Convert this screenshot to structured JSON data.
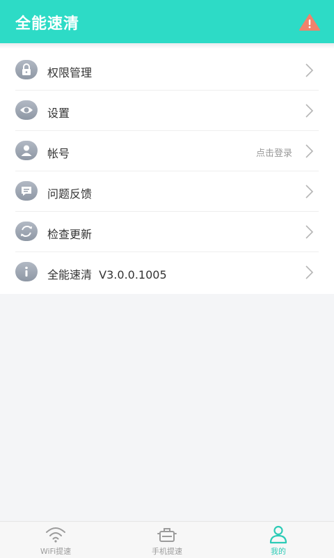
{
  "header": {
    "title": "全能速清",
    "alert_icon": "warning-triangle-icon",
    "accent_color": "#2ddbc6"
  },
  "menu": {
    "items": [
      {
        "icon": "lock-icon",
        "label": "权限管理",
        "value": ""
      },
      {
        "icon": "eye-settings-icon",
        "label": "设置",
        "value": ""
      },
      {
        "icon": "user-icon",
        "label": "帐号",
        "value": "点击登录"
      },
      {
        "icon": "message-icon",
        "label": "问题反馈",
        "value": ""
      },
      {
        "icon": "refresh-icon",
        "label": "检查更新",
        "value": ""
      },
      {
        "icon": "info-icon",
        "label": "全能速清  V3.0.0.1005",
        "value": ""
      }
    ]
  },
  "tabbar": {
    "tabs": [
      {
        "label": "WiFi提速",
        "icon": "wifi-icon",
        "active": false
      },
      {
        "label": "手机提速",
        "icon": "rocket-pot-icon",
        "active": false
      },
      {
        "label": "我的",
        "icon": "profile-icon",
        "active": true
      }
    ],
    "active_color": "#2ccbb6"
  }
}
